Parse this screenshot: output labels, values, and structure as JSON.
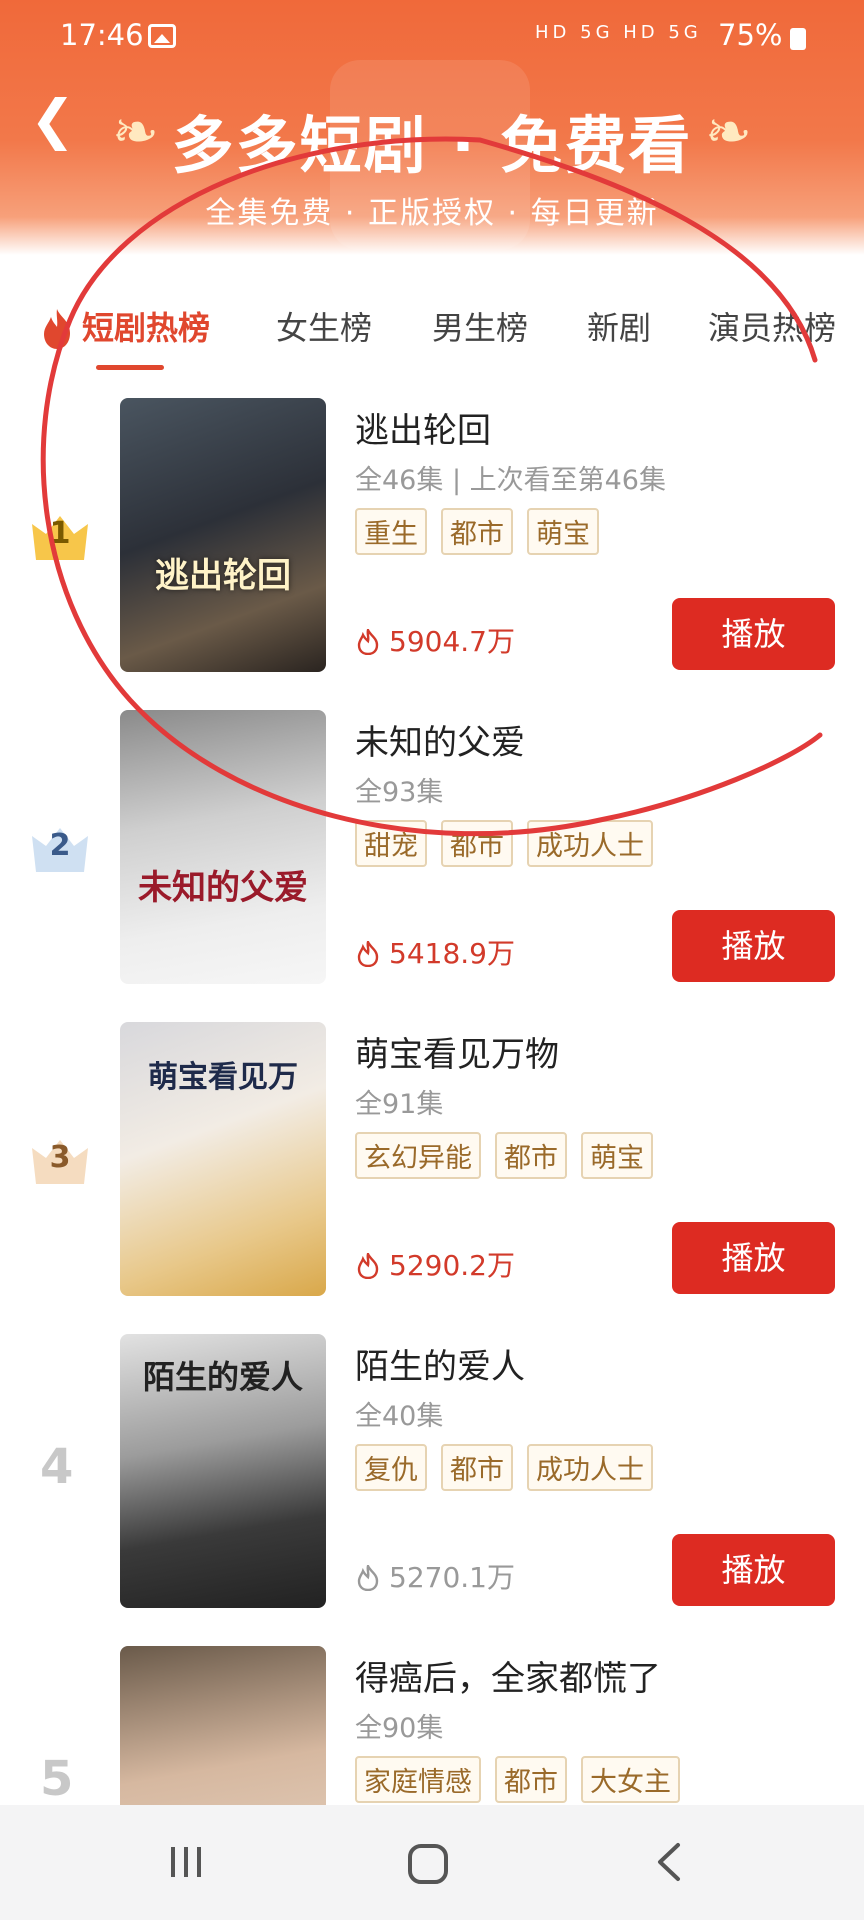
{
  "status_bar": {
    "time": "17:46",
    "network": "HD 5G HD 5G",
    "battery": "75%"
  },
  "header": {
    "title": "多多短剧 · 免费看",
    "subtitle": "全集免费 · 正版授权 · 每日更新"
  },
  "tabs": [
    {
      "label": "短剧热榜",
      "active": true
    },
    {
      "label": "女生榜"
    },
    {
      "label": "男生榜"
    },
    {
      "label": "新剧"
    },
    {
      "label": "演员热榜"
    }
  ],
  "list": [
    {
      "rank": "1",
      "title": "逃出轮回",
      "cover_title": "逃出轮回",
      "meta": "全46集 | 上次看至第46集",
      "tags": [
        "重生",
        "都市",
        "萌宝"
      ],
      "heat": "5904.7万",
      "play": "播放"
    },
    {
      "rank": "2",
      "title": "未知的父爱",
      "cover_title": "未知的父爱",
      "meta": "全93集",
      "tags": [
        "甜宠",
        "都市",
        "成功人士"
      ],
      "heat": "5418.9万",
      "play": "播放"
    },
    {
      "rank": "3",
      "title": "萌宝看见万物",
      "cover_title": "萌宝看见万",
      "meta": "全91集",
      "tags": [
        "玄幻异能",
        "都市",
        "萌宝"
      ],
      "heat": "5290.2万",
      "play": "播放"
    },
    {
      "rank": "4",
      "title": "陌生的爱人",
      "cover_title": "陌生的爱人",
      "meta": "全40集",
      "tags": [
        "复仇",
        "都市",
        "成功人士"
      ],
      "heat": "5270.1万",
      "play": "播放"
    },
    {
      "rank": "5",
      "title": "得癌后，全家都慌了",
      "cover_title": "",
      "meta": "全90集",
      "tags": [
        "家庭情感",
        "都市",
        "大女主"
      ]
    }
  ],
  "nav": {
    "recent_icon": "recent-apps-icon",
    "home_icon": "home-icon",
    "back_icon": "back-icon"
  },
  "colors": {
    "accent": "#e0472e",
    "play_button": "#dd2b22",
    "header": "#f0693a",
    "annotation": "#e23a3a"
  }
}
